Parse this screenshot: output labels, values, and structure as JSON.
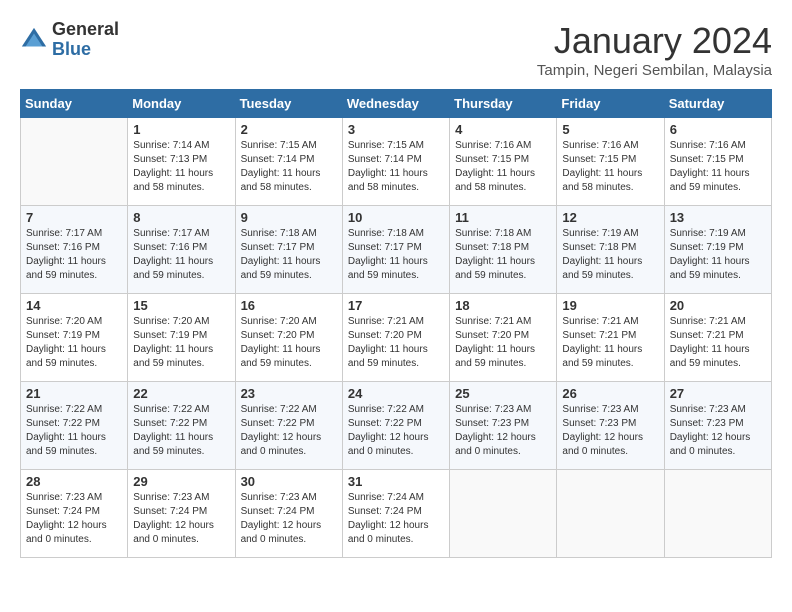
{
  "logo": {
    "general": "General",
    "blue": "Blue"
  },
  "header": {
    "month": "January 2024",
    "location": "Tampin, Negeri Sembilan, Malaysia"
  },
  "weekdays": [
    "Sunday",
    "Monday",
    "Tuesday",
    "Wednesday",
    "Thursday",
    "Friday",
    "Saturday"
  ],
  "weeks": [
    [
      {
        "day": "",
        "empty": true
      },
      {
        "day": "1",
        "sunrise": "7:14 AM",
        "sunset": "7:13 PM",
        "daylight": "Daylight: 11 hours and 58 minutes."
      },
      {
        "day": "2",
        "sunrise": "7:15 AM",
        "sunset": "7:14 PM",
        "daylight": "Daylight: 11 hours and 58 minutes."
      },
      {
        "day": "3",
        "sunrise": "7:15 AM",
        "sunset": "7:14 PM",
        "daylight": "Daylight: 11 hours and 58 minutes."
      },
      {
        "day": "4",
        "sunrise": "7:16 AM",
        "sunset": "7:15 PM",
        "daylight": "Daylight: 11 hours and 58 minutes."
      },
      {
        "day": "5",
        "sunrise": "7:16 AM",
        "sunset": "7:15 PM",
        "daylight": "Daylight: 11 hours and 58 minutes."
      },
      {
        "day": "6",
        "sunrise": "7:16 AM",
        "sunset": "7:15 PM",
        "daylight": "Daylight: 11 hours and 59 minutes."
      }
    ],
    [
      {
        "day": "7",
        "sunrise": "7:17 AM",
        "sunset": "7:16 PM",
        "daylight": "Daylight: 11 hours and 59 minutes."
      },
      {
        "day": "8",
        "sunrise": "7:17 AM",
        "sunset": "7:16 PM",
        "daylight": "Daylight: 11 hours and 59 minutes."
      },
      {
        "day": "9",
        "sunrise": "7:18 AM",
        "sunset": "7:17 PM",
        "daylight": "Daylight: 11 hours and 59 minutes."
      },
      {
        "day": "10",
        "sunrise": "7:18 AM",
        "sunset": "7:17 PM",
        "daylight": "Daylight: 11 hours and 59 minutes."
      },
      {
        "day": "11",
        "sunrise": "7:18 AM",
        "sunset": "7:18 PM",
        "daylight": "Daylight: 11 hours and 59 minutes."
      },
      {
        "day": "12",
        "sunrise": "7:19 AM",
        "sunset": "7:18 PM",
        "daylight": "Daylight: 11 hours and 59 minutes."
      },
      {
        "day": "13",
        "sunrise": "7:19 AM",
        "sunset": "7:19 PM",
        "daylight": "Daylight: 11 hours and 59 minutes."
      }
    ],
    [
      {
        "day": "14",
        "sunrise": "7:20 AM",
        "sunset": "7:19 PM",
        "daylight": "Daylight: 11 hours and 59 minutes."
      },
      {
        "day": "15",
        "sunrise": "7:20 AM",
        "sunset": "7:19 PM",
        "daylight": "Daylight: 11 hours and 59 minutes."
      },
      {
        "day": "16",
        "sunrise": "7:20 AM",
        "sunset": "7:20 PM",
        "daylight": "Daylight: 11 hours and 59 minutes."
      },
      {
        "day": "17",
        "sunrise": "7:21 AM",
        "sunset": "7:20 PM",
        "daylight": "Daylight: 11 hours and 59 minutes."
      },
      {
        "day": "18",
        "sunrise": "7:21 AM",
        "sunset": "7:20 PM",
        "daylight": "Daylight: 11 hours and 59 minutes."
      },
      {
        "day": "19",
        "sunrise": "7:21 AM",
        "sunset": "7:21 PM",
        "daylight": "Daylight: 11 hours and 59 minutes."
      },
      {
        "day": "20",
        "sunrise": "7:21 AM",
        "sunset": "7:21 PM",
        "daylight": "Daylight: 11 hours and 59 minutes."
      }
    ],
    [
      {
        "day": "21",
        "sunrise": "7:22 AM",
        "sunset": "7:22 PM",
        "daylight": "Daylight: 11 hours and 59 minutes."
      },
      {
        "day": "22",
        "sunrise": "7:22 AM",
        "sunset": "7:22 PM",
        "daylight": "Daylight: 11 hours and 59 minutes."
      },
      {
        "day": "23",
        "sunrise": "7:22 AM",
        "sunset": "7:22 PM",
        "daylight": "Daylight: 12 hours and 0 minutes."
      },
      {
        "day": "24",
        "sunrise": "7:22 AM",
        "sunset": "7:22 PM",
        "daylight": "Daylight: 12 hours and 0 minutes."
      },
      {
        "day": "25",
        "sunrise": "7:23 AM",
        "sunset": "7:23 PM",
        "daylight": "Daylight: 12 hours and 0 minutes."
      },
      {
        "day": "26",
        "sunrise": "7:23 AM",
        "sunset": "7:23 PM",
        "daylight": "Daylight: 12 hours and 0 minutes."
      },
      {
        "day": "27",
        "sunrise": "7:23 AM",
        "sunset": "7:23 PM",
        "daylight": "Daylight: 12 hours and 0 minutes."
      }
    ],
    [
      {
        "day": "28",
        "sunrise": "7:23 AM",
        "sunset": "7:24 PM",
        "daylight": "Daylight: 12 hours and 0 minutes."
      },
      {
        "day": "29",
        "sunrise": "7:23 AM",
        "sunset": "7:24 PM",
        "daylight": "Daylight: 12 hours and 0 minutes."
      },
      {
        "day": "30",
        "sunrise": "7:23 AM",
        "sunset": "7:24 PM",
        "daylight": "Daylight: 12 hours and 0 minutes."
      },
      {
        "day": "31",
        "sunrise": "7:24 AM",
        "sunset": "7:24 PM",
        "daylight": "Daylight: 12 hours and 0 minutes."
      },
      {
        "day": "",
        "empty": true
      },
      {
        "day": "",
        "empty": true
      },
      {
        "day": "",
        "empty": true
      }
    ]
  ]
}
